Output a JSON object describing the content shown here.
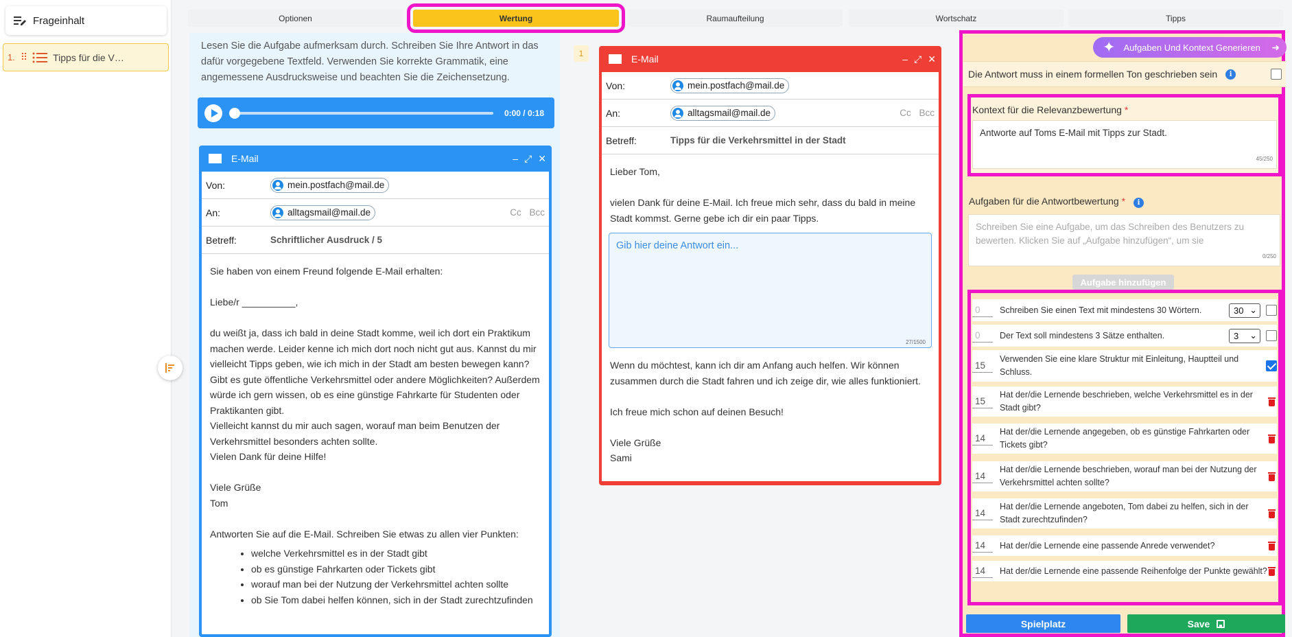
{
  "sidebar": {
    "header": "Frageinhalt",
    "items": [
      {
        "number": "1.",
        "label": "Tipps für die V…"
      }
    ]
  },
  "tabs": [
    {
      "label": "Optionen",
      "active": false
    },
    {
      "label": "Wertung",
      "active": true
    },
    {
      "label": "Raumaufteilung",
      "active": false
    },
    {
      "label": "Wortschatz",
      "active": false
    },
    {
      "label": "Tipps",
      "active": false
    }
  ],
  "left": {
    "intro": "Lesen Sie die Aufgabe aufmerksam durch. Schreiben Sie Ihre Antwort in das dafür vorgegebene Textfeld. Verwenden Sie korrekte Grammatik, eine angemessene Ausdrucksweise und beachten Sie die Zeichensetzung.",
    "audio_time": "0:00 / 0:18",
    "email": {
      "title": "E-Mail",
      "from_label": "Von:",
      "from": "mein.postfach@mail.de",
      "to_label": "An:",
      "to": "alltagsmail@mail.de",
      "cc": "Cc",
      "bcc": "Bcc",
      "subject_label": "Betreff:",
      "subject": "Schriftlicher Ausdruck / 5",
      "p1": "Sie haben von einem Freund folgende E-Mail erhalten:",
      "p2": "Liebe/r __________,",
      "p3": "du weißt ja, dass ich bald in deine Stadt komme, weil ich dort ein Praktikum machen werde. Leider kenne ich mich dort noch nicht gut aus. Kannst du mir vielleicht Tipps geben, wie ich mich in der Stadt am besten bewegen kann? Gibt es gute öffentliche Verkehrsmittel oder andere Möglichkeiten? Außerdem würde ich gern wissen, ob es eine günstige Fahrkarte für Studenten oder Praktikanten gibt.",
      "p4": "Vielleicht kannst du mir auch sagen, worauf man beim Benutzen der Verkehrsmittel besonders achten sollte.",
      "p5": "Vielen Dank für deine Hilfe!",
      "p6": "Viele Grüße",
      "p7": "Tom",
      "p8": "Antworten Sie auf die E-Mail. Schreiben Sie etwas zu allen vier Punkten:",
      "bullets": [
        "welche Verkehrsmittel es in der Stadt gibt",
        "ob es günstige Fahrkarten oder Tickets gibt",
        "worauf man bei der Nutzung der Verkehrsmittel achten sollte",
        "ob Sie Tom dabei helfen können, sich in der Stadt zurechtzufinden"
      ]
    }
  },
  "middle": {
    "number": "1",
    "email": {
      "title": "E-Mail",
      "from_label": "Von:",
      "from": "mein.postfach@mail.de",
      "to_label": "An:",
      "to": "alltagsmail@mail.de",
      "cc": "Cc",
      "bcc": "Bcc",
      "subject_label": "Betreff:",
      "subject": "Tipps für die Verkehrsmittel in der Stadt",
      "p1": "Lieber Tom,",
      "p2": "vielen Dank für deine E-Mail. Ich freue mich sehr, dass du bald in meine Stadt kommst. Gerne gebe ich dir ein paar Tipps.",
      "answer_placeholder": "Gib hier deine Antwort ein...",
      "answer_count": "27/1500",
      "p3": "Wenn du möchtest, kann ich dir am Anfang auch helfen. Wir können zusammen durch die Stadt fahren und ich zeige dir, wie alles funktioniert.",
      "p4": "Ich freue mich schon auf deinen Besuch!",
      "p5": "Viele Grüße",
      "p6": "Sami"
    }
  },
  "right": {
    "generate_button": "Aufgaben Und Kontext Generieren",
    "formal_label": "Die Antwort muss in einem formellen Ton geschrieben sein",
    "context_label": "Kontext für die Relevanzbewertung",
    "context_value": "Antworte auf Toms E-Mail mit Tipps zur Stadt.",
    "context_count": "45/250",
    "tasks_label": "Aufgaben für die Antwortbewertung",
    "tasks_placeholder": "Schreiben Sie eine Aufgabe, um das Schreiben des Benutzers zu bewerten. Klicken Sie auf „Aufgabe hinzufügen“, um sie",
    "tasks_count": "0/250",
    "add_task_button": "Aufgabe hinzufügen",
    "tasks": [
      {
        "score": "0",
        "text": "Schreiben Sie einen Text mit mindestens 30 Wörtern.",
        "select": "30",
        "control": "checkbox",
        "checked": false
      },
      {
        "score": "0",
        "text": "Der Text soll mindestens 3 Sätze enthalten.",
        "select": "3",
        "control": "checkbox",
        "checked": false
      },
      {
        "score": "15",
        "text": "Verwenden Sie eine klare Struktur mit Einleitung, Hauptteil und Schluss.",
        "control": "checkbox",
        "checked": true
      },
      {
        "score": "15",
        "text": "Hat der/die Lernende beschrieben, welche Verkehrsmittel es in der Stadt gibt?",
        "control": "trash"
      },
      {
        "score": "14",
        "text": "Hat der/die Lernende angegeben, ob es günstige Fahrkarten oder Tickets gibt?",
        "control": "trash"
      },
      {
        "score": "14",
        "text": "Hat der/die Lernende beschrieben, worauf man bei der Nutzung der Verkehrsmittel achten sollte?",
        "control": "trash"
      },
      {
        "score": "14",
        "text": "Hat der/die Lernende angeboten, Tom dabei zu helfen, sich in der Stadt zurechtzufinden?",
        "control": "trash"
      },
      {
        "score": "14",
        "text": "Hat der/die Lernende eine passende Anrede verwendet?",
        "control": "trash"
      },
      {
        "score": "14",
        "text": "Hat der/die Lernende eine passende Reihenfolge der Punkte gewählt?",
        "control": "trash"
      }
    ],
    "playground_button": "Spielplatz",
    "save_button": "Save"
  },
  "colors": {
    "accent_yellow": "#fac41c",
    "highlight_magenta": "#ee16c8",
    "email_blue": "#2b93f3",
    "email_red": "#ef3e36",
    "save_green": "#1ea85c"
  }
}
